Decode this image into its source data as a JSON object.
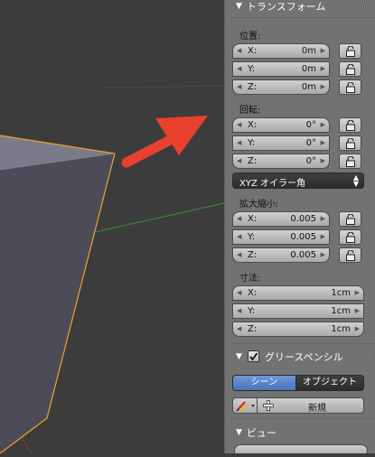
{
  "transform_panel": {
    "title": "トランスフォーム",
    "location": {
      "label": "位置:",
      "fields": [
        {
          "axis": "X:",
          "value": "0m"
        },
        {
          "axis": "Y:",
          "value": "0m"
        },
        {
          "axis": "Z:",
          "value": "0m"
        }
      ]
    },
    "rotation": {
      "label": "回転:",
      "fields": [
        {
          "axis": "X:",
          "value": "0°"
        },
        {
          "axis": "Y:",
          "value": "0°"
        },
        {
          "axis": "Z:",
          "value": "0°"
        }
      ],
      "mode": "XYZ オイラー角"
    },
    "scale": {
      "label": "拡大縮小:",
      "fields": [
        {
          "axis": "X:",
          "value": "0.005"
        },
        {
          "axis": "Y:",
          "value": "0.005"
        },
        {
          "axis": "Z:",
          "value": "0.005"
        }
      ]
    },
    "dimensions": {
      "label": "寸法:",
      "fields": [
        {
          "axis": "X:",
          "value": "1cm"
        },
        {
          "axis": "Y:",
          "value": "1cm"
        },
        {
          "axis": "Z:",
          "value": "1cm"
        }
      ]
    }
  },
  "grease_pencil_panel": {
    "title": "グリースペンシル",
    "enabled": true,
    "scene_tab": "シーン",
    "object_tab": "オブジェクト",
    "new_button": "新規"
  },
  "view_panel": {
    "title": "ビュー"
  },
  "colors": {
    "panel_bg": "#727272",
    "viewport_bg": "#3c3c3c",
    "selection_outline": "#f0a030",
    "annotation_arrow": "#e8412e",
    "active_tab": "#5680c2"
  }
}
